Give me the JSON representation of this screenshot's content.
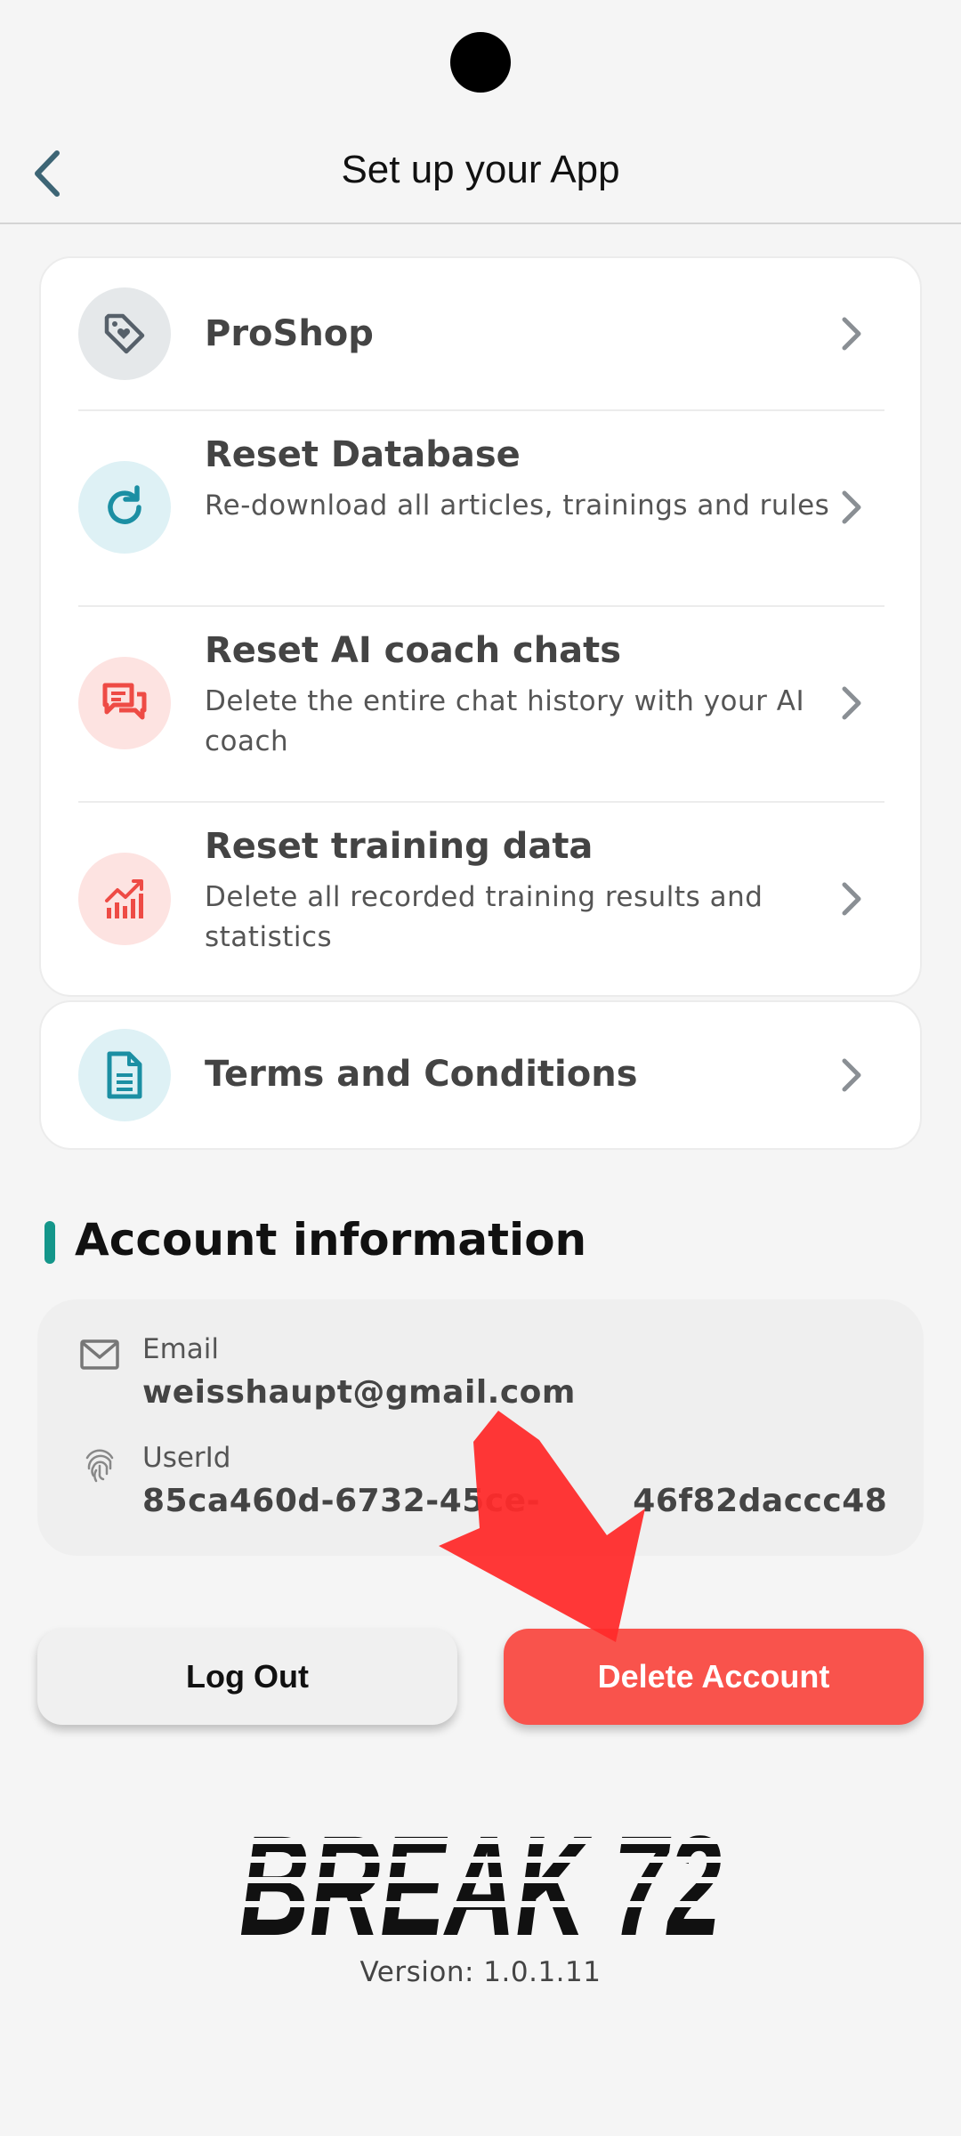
{
  "header": {
    "title": "Set up your App"
  },
  "menu": [
    {
      "title": "ProShop",
      "subtitle": "",
      "icon": "tag-heart-icon"
    },
    {
      "title": "Reset Database",
      "subtitle": "Re-download all articles, trainings and rules",
      "icon": "refresh-icon"
    },
    {
      "title": "Reset AI coach chats",
      "subtitle": "Delete the entire chat history with your AI coach",
      "icon": "chat-icon"
    },
    {
      "title": "Reset training data",
      "subtitle": "Delete all recorded training results and statistics",
      "icon": "chart-icon"
    }
  ],
  "terms": {
    "title": "Terms and Conditions",
    "icon": "document-icon"
  },
  "account": {
    "section_title": "Account information",
    "email_label": "Email",
    "email_value": "weisshaupt@gmail.com",
    "userid_label": "UserId",
    "userid_value": "85ca460d-6732-45ce-        46f82daccc48"
  },
  "buttons": {
    "logout": "Log Out",
    "delete": "Delete Account"
  },
  "footer": {
    "logo_text": "BREAK 72",
    "version": "Version: 1.0.1.11"
  },
  "colors": {
    "accent": "#14968a",
    "danger": "#f9534c",
    "arrow": "#ff2a2a"
  }
}
